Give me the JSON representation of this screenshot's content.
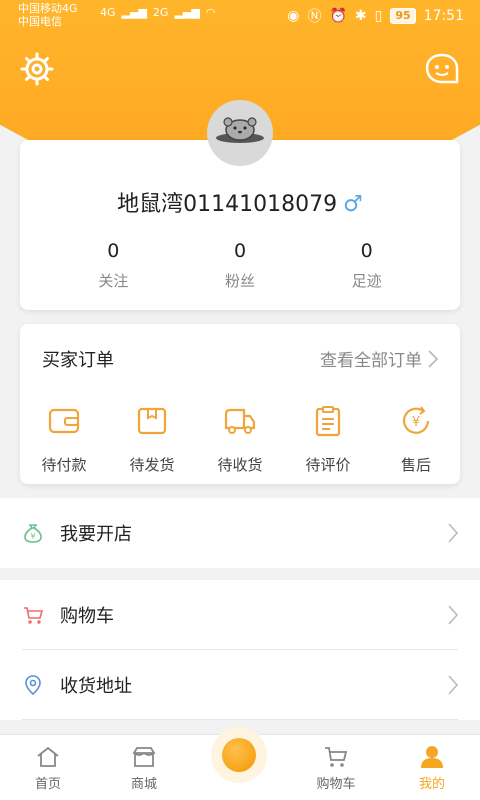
{
  "status_bar": {
    "carrier1": "中国移动4G",
    "carrier2": "中国电信",
    "net1": "4G",
    "net2": "2G",
    "battery": "95",
    "time": "17:51"
  },
  "header": {
    "settings_icon": "gear-icon",
    "message_icon": "message-icon"
  },
  "profile": {
    "username": "地鼠湾01141018079",
    "gender_symbol": "♂",
    "stats": [
      {
        "value": "0",
        "label": "关注"
      },
      {
        "value": "0",
        "label": "粉丝"
      },
      {
        "value": "0",
        "label": "足迹"
      }
    ]
  },
  "orders": {
    "title": "买家订单",
    "view_all": "查看全部订单",
    "items": [
      {
        "label": "待付款",
        "icon": "wallet-icon"
      },
      {
        "label": "待发货",
        "icon": "package-icon"
      },
      {
        "label": "待收货",
        "icon": "truck-icon"
      },
      {
        "label": "待评价",
        "icon": "review-icon"
      },
      {
        "label": "售后",
        "icon": "refund-icon"
      }
    ]
  },
  "menu": {
    "open_shop": "我要开店",
    "cart": "购物车",
    "address": "收货地址"
  },
  "tabbar": {
    "items": [
      {
        "label": "首页"
      },
      {
        "label": "商城"
      },
      {
        "label": ""
      },
      {
        "label": "购物车"
      },
      {
        "label": "我的"
      }
    ]
  },
  "colors": {
    "accent": "#f5a623",
    "header_gradient": "#ffa321"
  }
}
